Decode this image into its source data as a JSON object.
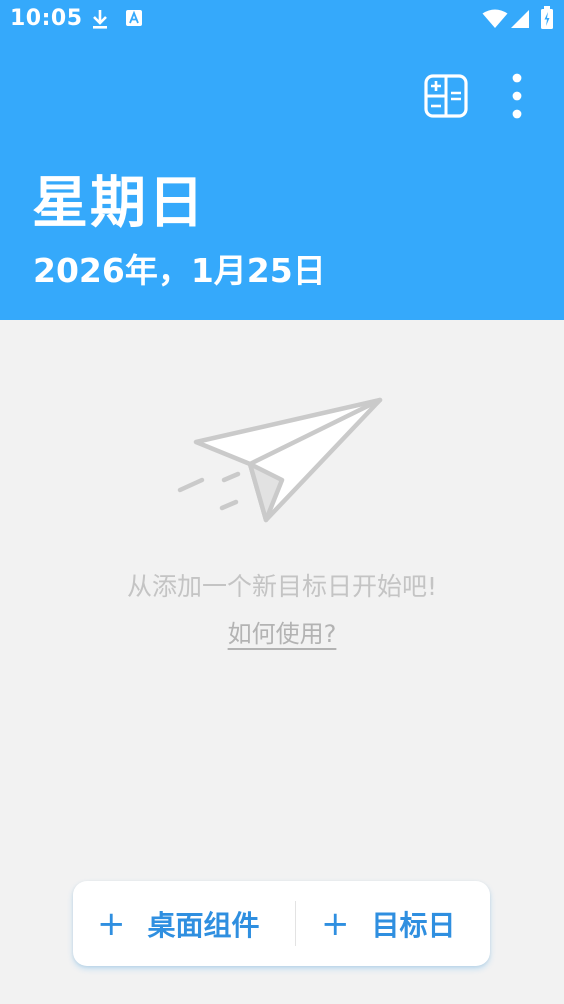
{
  "status_bar": {
    "time": "10:05"
  },
  "header": {
    "day": "星期日",
    "date": "2026年，1月25日"
  },
  "empty_state": {
    "message": "从添加一个新目标日开始吧!",
    "help_link": "如何使用?"
  },
  "actions": {
    "plus_symbol": "+",
    "widget_label": "桌面组件",
    "target_label": "目标日"
  },
  "colors": {
    "header_bg": "#35a9fb",
    "accent": "#2f8fe0",
    "background": "#f2f2f2"
  },
  "icons": {
    "calculator": "calculator-icon",
    "overflow_menu": "more-vert-icon",
    "download": "download-icon",
    "font_notice": "font-a-icon",
    "wifi": "wifi-icon",
    "signal": "signal-icon",
    "battery": "battery-icon",
    "empty_state": "paper-plane-icon"
  }
}
